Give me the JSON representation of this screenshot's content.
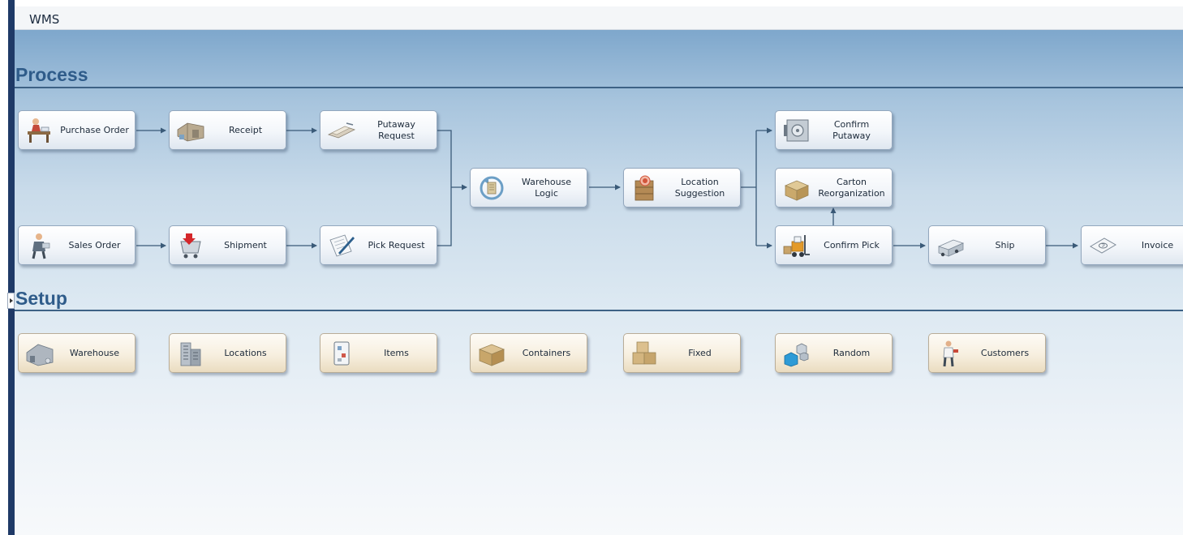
{
  "app": {
    "title": "WMS"
  },
  "sections": {
    "process": "Process",
    "setup": "Setup"
  },
  "process_nodes": {
    "purchase_order": {
      "label": "Purchase Order",
      "icon": "office-worker-icon"
    },
    "receipt": {
      "label": "Receipt",
      "icon": "warehouse-building-icon"
    },
    "putaway_request": {
      "label": "Putaway Request",
      "icon": "forklift-pallet-icon"
    },
    "warehouse_logic": {
      "label": "Warehouse Logic",
      "icon": "warehouse-logic-icon"
    },
    "location_suggestion": {
      "label": "Location\nSuggestion",
      "icon": "shelf-target-icon"
    },
    "confirm_putaway": {
      "label": "Confirm Putaway",
      "icon": "safe-icon"
    },
    "carton_reorganization": {
      "label": "Carton\nReorganization",
      "icon": "open-box-icon"
    },
    "confirm_pick": {
      "label": "Confirm Pick",
      "icon": "forklift-icon"
    },
    "ship": {
      "label": "Ship",
      "icon": "truck-icon"
    },
    "invoice": {
      "label": "Invoice",
      "icon": "money-icon"
    },
    "sales_order": {
      "label": "Sales Order",
      "icon": "salesperson-icon"
    },
    "shipment": {
      "label": "Shipment",
      "icon": "cart-icon"
    },
    "pick_request": {
      "label": "Pick Request",
      "icon": "document-pen-icon"
    }
  },
  "setup_nodes": {
    "warehouse": {
      "label": "Warehouse",
      "icon": "warehouse-icon"
    },
    "locations": {
      "label": "Locations",
      "icon": "buildings-icon"
    },
    "items": {
      "label": "Items",
      "icon": "items-icon"
    },
    "containers": {
      "label": "Containers",
      "icon": "box-icon"
    },
    "fixed": {
      "label": "Fixed",
      "icon": "stacked-boxes-icon"
    },
    "random": {
      "label": "Random",
      "icon": "cubes-icon"
    },
    "customers": {
      "label": "Customers",
      "icon": "customer-icon"
    }
  },
  "colors": {
    "rail": "#1f3a67",
    "section_title": "#2f5c8a",
    "connector": "#3a5a78",
    "process_node": "#f3f6fa",
    "setup_node": "#f7efdf"
  }
}
